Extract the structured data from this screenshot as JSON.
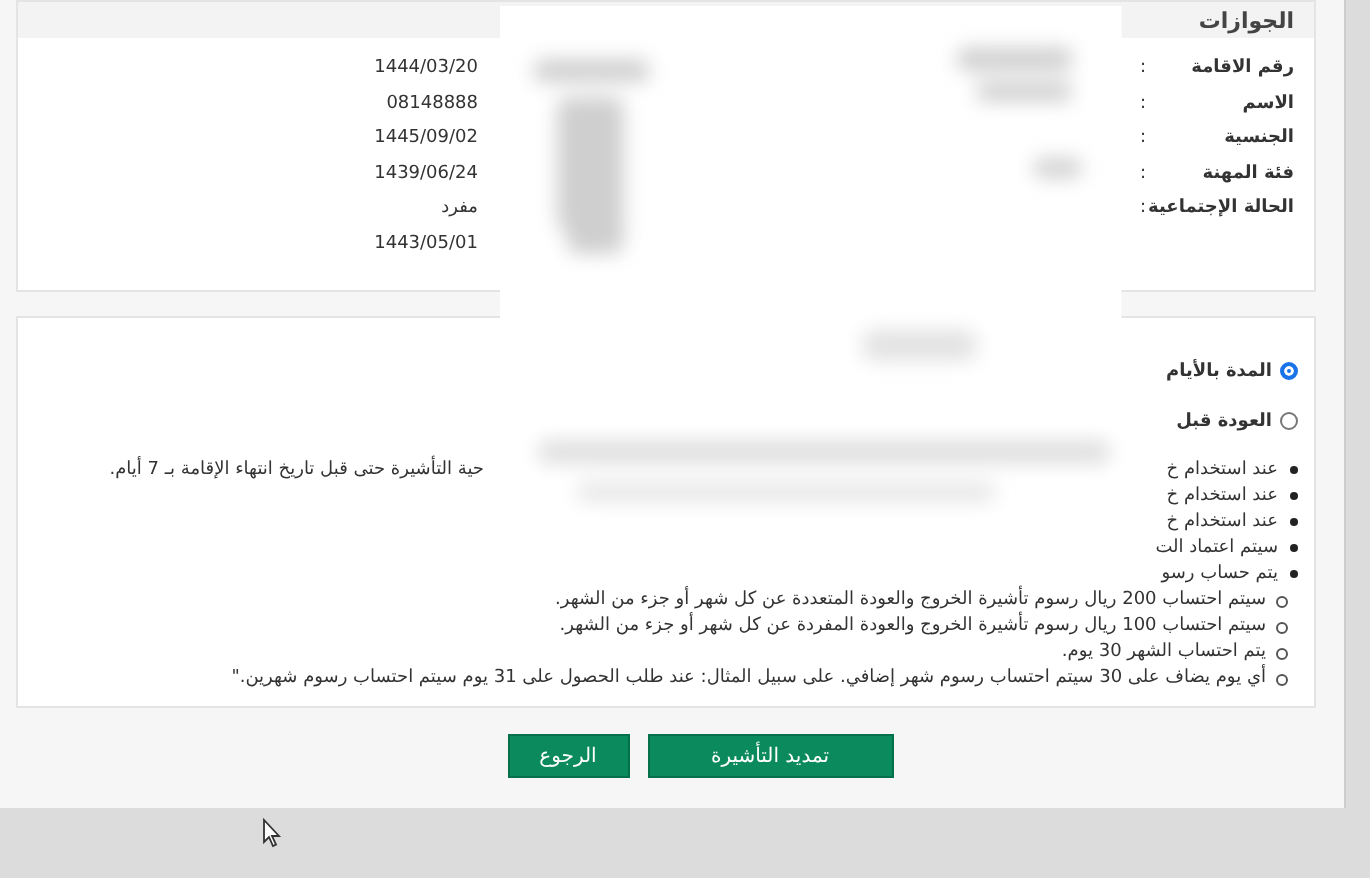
{
  "section_title": "الجوازات",
  "details": [
    {
      "label": "رقم الاقامة",
      "separator": ":",
      "value": "1444/03/20"
    },
    {
      "label": "الاسم",
      "separator": ":",
      "value": "08148888"
    },
    {
      "label": "الجنسية",
      "separator": ":",
      "value": "1445/09/02"
    },
    {
      "label": "فئة المهنة",
      "separator": ":",
      "value": "1439/06/24"
    },
    {
      "label": "الحالة الإجتماعية",
      "separator": ":",
      "value": "مفرد"
    },
    {
      "value": "1443/05/01"
    }
  ],
  "options": [
    {
      "label": "المدة بالأيام",
      "selected": true
    },
    {
      "label": "العودة قبل",
      "selected": false
    }
  ],
  "notes": [
    {
      "right": "عند استخدام خ",
      "left": "حية التأشيرة حتى قبل تاريخ انتهاء الإقامة بـ 7 أيام."
    },
    {
      "right": "عند استخدام خ"
    },
    {
      "right": "عند استخدام خ"
    },
    {
      "right": "سيتم اعتماد الت"
    },
    {
      "right": "يتم حساب رسو",
      "children": [
        "سيتم احتساب 200 ريال رسوم تأشيرة الخروج والعودة المتعددة عن كل شهر أو جزء من الشهر.",
        "سيتم احتساب 100 ريال رسوم تأشيرة الخروج والعودة المفردة عن كل شهر أو جزء من الشهر.",
        "يتم احتساب الشهر 30 يوم.",
        "أي يوم يضاف على 30 سيتم احتساب رسوم شهر إضافي. على سبيل المثال: عند طلب الحصول على 31 يوم سيتم احتساب رسوم شهرين.\""
      ]
    }
  ],
  "buttons": [
    {
      "label": "تمديد التأشيرة"
    },
    {
      "label": "الرجوع"
    }
  ]
}
